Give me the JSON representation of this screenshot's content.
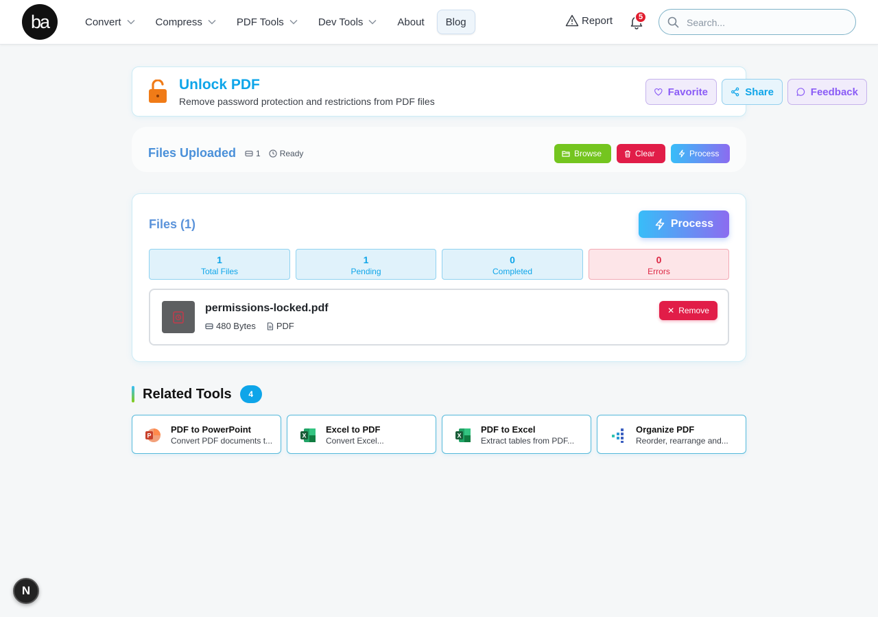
{
  "header": {
    "logo_text": "ba",
    "nav": [
      {
        "label": "Convert",
        "dropdown": true
      },
      {
        "label": "Compress",
        "dropdown": true
      },
      {
        "label": "PDF Tools",
        "dropdown": true
      },
      {
        "label": "Dev Tools",
        "dropdown": true
      },
      {
        "label": "About",
        "dropdown": false
      },
      {
        "label": "Blog",
        "dropdown": false,
        "active": true
      }
    ],
    "report_label": "Report",
    "notification_count": "5",
    "search_placeholder": "Search..."
  },
  "tool": {
    "title": "Unlock PDF",
    "subtitle": "Remove password protection and restrictions from PDF files",
    "icon": "unlock-icon",
    "favorite_label": "Favorite",
    "share_label": "Share",
    "feedback_label": "Feedback"
  },
  "upload": {
    "title": "Files Uploaded",
    "file_count": "1",
    "status": "Ready",
    "browse_label": "Browse",
    "clear_label": "Clear",
    "process_label": "Process"
  },
  "files": {
    "title": "Files (1)",
    "process_label": "Process",
    "stats": [
      {
        "value": "1",
        "label": "Total Files",
        "tone": "blue"
      },
      {
        "value": "1",
        "label": "Pending",
        "tone": "blue"
      },
      {
        "value": "0",
        "label": "Completed",
        "tone": "blue"
      },
      {
        "value": "0",
        "label": "Errors",
        "tone": "red"
      }
    ],
    "items": [
      {
        "name": "permissions-locked.pdf",
        "size": "480 Bytes",
        "type": "PDF",
        "remove_label": "Remove"
      }
    ]
  },
  "related": {
    "title": "Related Tools",
    "count": "4",
    "tools": [
      {
        "name": "PDF to PowerPoint",
        "description": "Convert PDF documents t...",
        "icon": "powerpoint-icon"
      },
      {
        "name": "Excel to PDF",
        "description": "Convert Excel...",
        "icon": "excel-icon"
      },
      {
        "name": "PDF to Excel",
        "description": "Extract tables from PDF...",
        "icon": "excel-icon"
      },
      {
        "name": "Organize PDF",
        "description": "Reorder, rearrange and...",
        "icon": "organize-icon"
      }
    ]
  },
  "dev_badge": "N",
  "colors": {
    "accent": "#0ea5e9",
    "purple": "#8b5cf6",
    "danger": "#e11d48",
    "success": "#74c51f",
    "lock": "#f07b17"
  }
}
